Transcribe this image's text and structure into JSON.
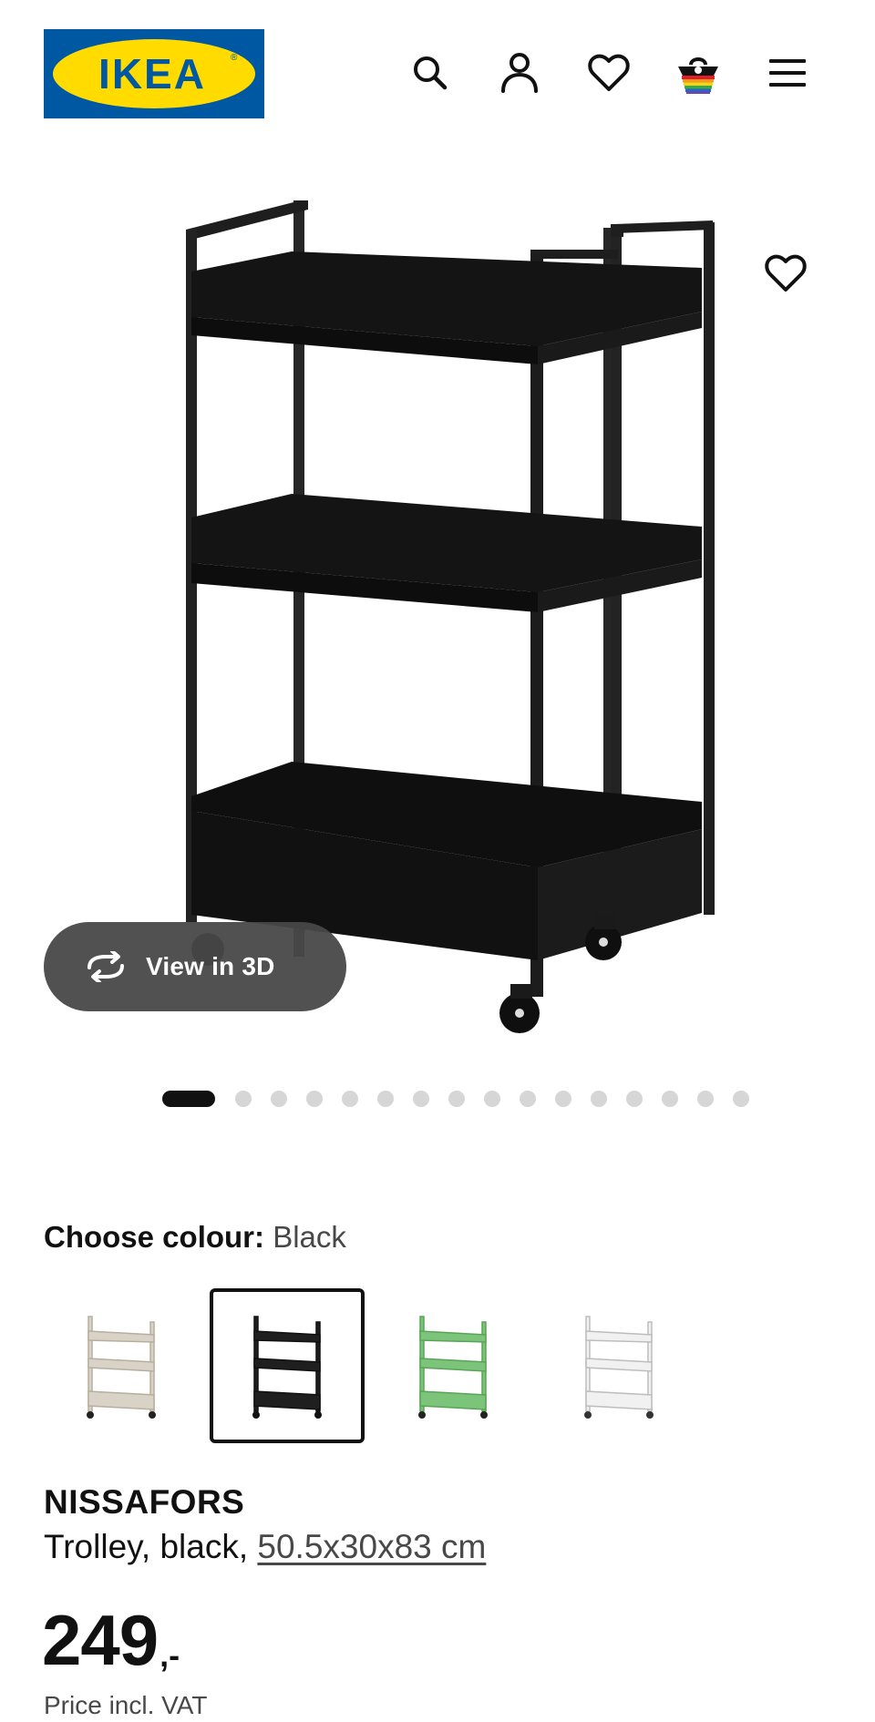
{
  "header": {
    "logo_text": "IKEA",
    "icons": [
      "search-icon",
      "account-icon",
      "heart-icon",
      "basket-icon",
      "menu-icon"
    ],
    "brand_colors": {
      "blue": "#0058a3",
      "yellow": "#ffdb00"
    }
  },
  "gallery": {
    "view_3d_label": "View in 3D",
    "total_images": 16,
    "active_image": 1
  },
  "colour": {
    "label": "Choose colour:",
    "selected": "Black",
    "options": [
      {
        "name": "beige",
        "color": "#d9d2c6"
      },
      {
        "name": "black",
        "color": "#1f1f1f"
      },
      {
        "name": "green",
        "color": "#7cc47a"
      },
      {
        "name": "white",
        "color": "#f1f1f1"
      }
    ]
  },
  "product": {
    "name": "NISSAFORS",
    "description_prefix": "Trolley, black, ",
    "dimensions_link": "50.5x30x83 cm",
    "price_integer": "249",
    "price_suffix": ",-",
    "vat_note": "Price incl. VAT"
  }
}
